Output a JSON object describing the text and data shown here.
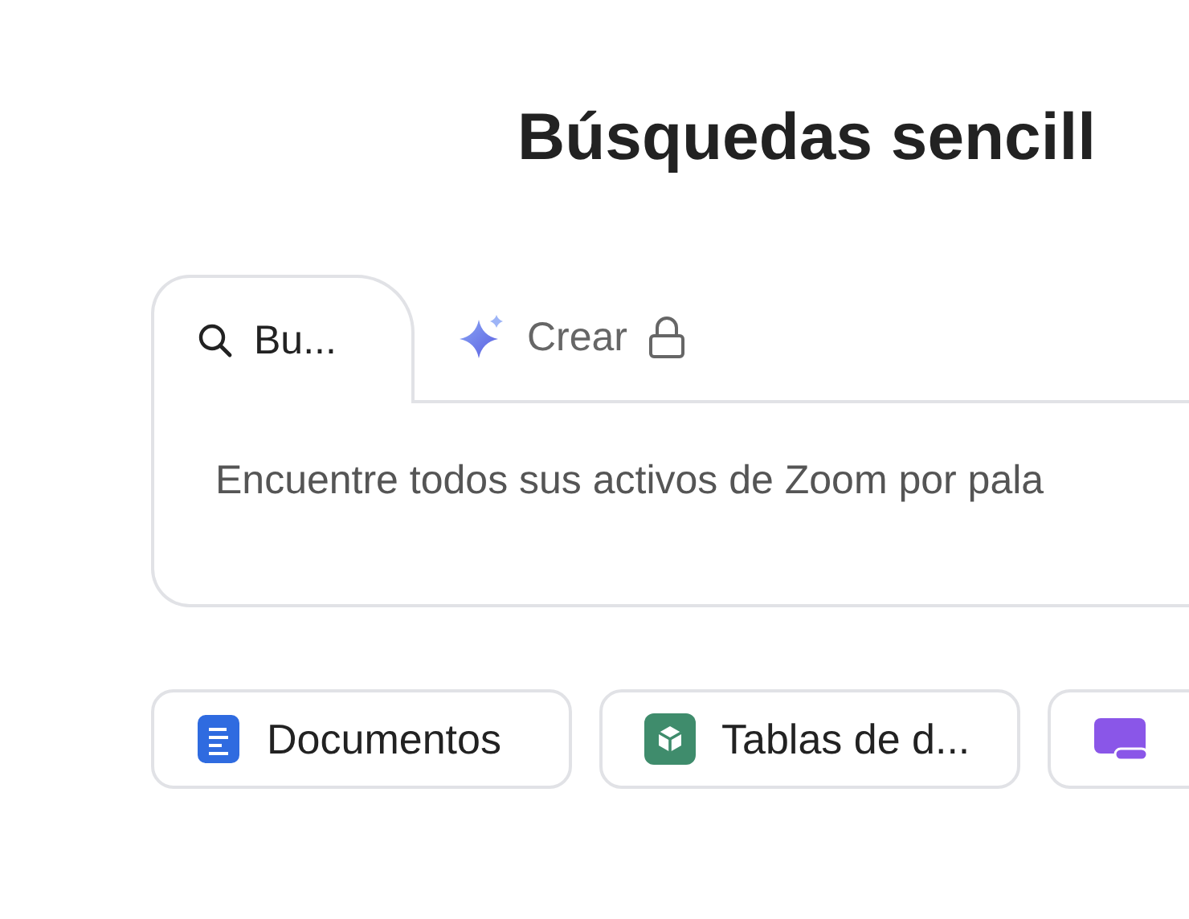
{
  "heading": "Búsquedas sencill",
  "tabs": [
    {
      "label": "Bu...",
      "kind": "search",
      "selected": true,
      "locked": false
    },
    {
      "label": "Crear",
      "kind": "sparkle",
      "selected": false,
      "locked": true
    }
  ],
  "description": "Encuentre todos sus activos de Zoom por pala",
  "chips": [
    {
      "label": "Documentos",
      "kind": "doc",
      "color": "#2f6be0"
    },
    {
      "label": "Tablas de d...",
      "kind": "cube",
      "color": "#3f8c6c"
    },
    {
      "kind": "slides",
      "color": "#8a56e8"
    }
  ]
}
